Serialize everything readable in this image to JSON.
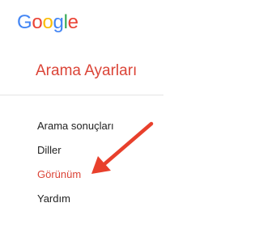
{
  "logo": {
    "letters": [
      "G",
      "o",
      "o",
      "g",
      "l",
      "e"
    ],
    "colors": [
      "#4285f4",
      "#ea4335",
      "#fbbc05",
      "#4285f4",
      "#34a853",
      "#ea4335"
    ]
  },
  "heading": "Arama Ayarları",
  "nav": {
    "items": [
      {
        "label": "Arama sonuçları",
        "active": false
      },
      {
        "label": "Diller",
        "active": false
      },
      {
        "label": "Görünüm",
        "active": true
      },
      {
        "label": "Yardım",
        "active": false
      }
    ]
  },
  "colors": {
    "accent": "#db4437",
    "text": "#222222",
    "arrow": "#e8402c",
    "divider": "#e4e4e4"
  },
  "annotation": {
    "icon": "red-arrow-icon",
    "points_to": "Görünüm"
  }
}
